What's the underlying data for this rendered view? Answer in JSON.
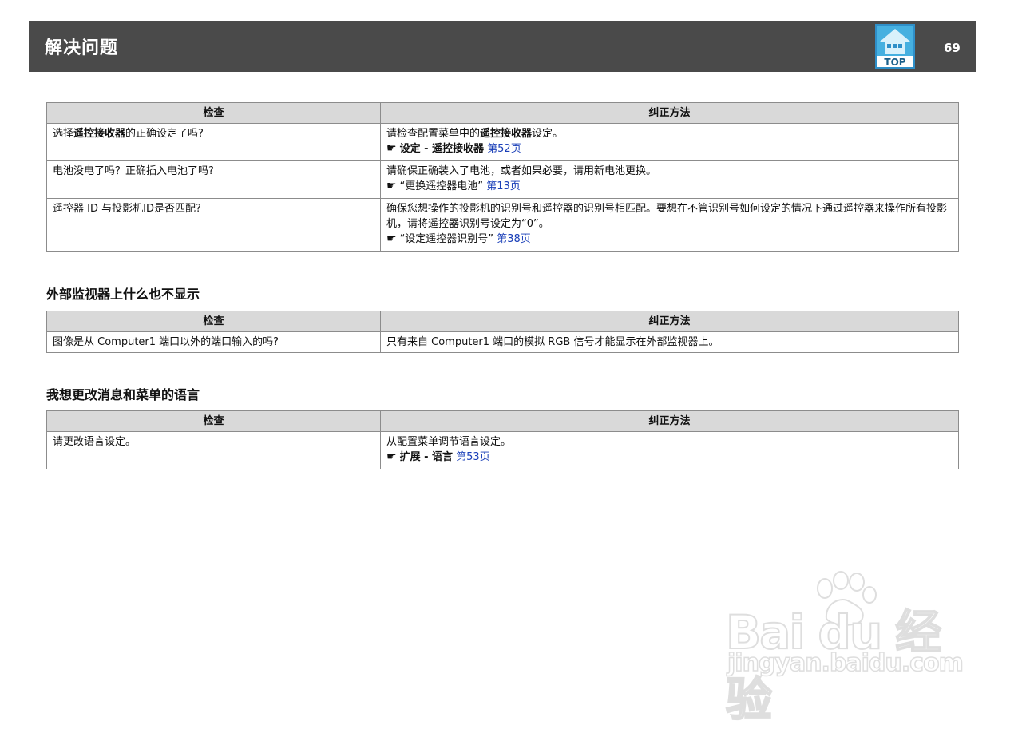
{
  "header": {
    "title": "解决问题",
    "top_label": "TOP",
    "page_number": "69"
  },
  "table_headers": {
    "check": "检查",
    "remedy": "纠正方法"
  },
  "table1": {
    "rows": [
      {
        "check_pre": "选择",
        "check_bold": "遥控接收器",
        "check_post": "的正确设定了吗?",
        "remedy_pre": "请检查配置菜单中的",
        "remedy_bold": "遥控接收器",
        "remedy_post": "设定。",
        "ref_text": "设定 - 遥控接收器",
        "ref_link": "第52页"
      },
      {
        "check": "电池没电了吗？正确插入电池了吗?",
        "remedy": "请确保正确装入了电池，或者如果必要，请用新电池更换。",
        "ref_text": "“更换遥控器电池”",
        "ref_link": "第13页"
      },
      {
        "check": "遥控器 ID 与投影机ID是否匹配?",
        "remedy": "确保您想操作的投影机的识别号和遥控器的识别号相匹配。要想在不管识别号如何设定的情况下通过遥控器来操作所有投影机，请将遥控器识别号设定为“0”。",
        "ref_text": "“设定遥控器识别号”",
        "ref_link": "第38页"
      }
    ]
  },
  "section2": {
    "title": "外部监视器上什么也不显示",
    "rows": [
      {
        "check": "图像是从 Computer1 端口以外的端口输入的吗?",
        "remedy": "只有来自 Computer1 端口的模拟 RGB 信号才能显示在外部监视器上。"
      }
    ]
  },
  "section3": {
    "title": "我想更改消息和菜单的语言",
    "rows": [
      {
        "check": "请更改语言设定。",
        "remedy": "从配置菜单调节语言设定。",
        "ref_text": "扩展 - 语言",
        "ref_link": "第53页"
      }
    ]
  },
  "icons": {
    "reference": "pointing-hand-icon",
    "top": "house-icon"
  },
  "watermark": {
    "brand": "Bai du 经验",
    "url": "jingyan.baidu.com"
  },
  "colors": {
    "header_bg": "#4a4a4a",
    "table_header_bg": "#d9d9d9",
    "link": "#1a3fb8",
    "top_icon": "#3aa3d6"
  }
}
